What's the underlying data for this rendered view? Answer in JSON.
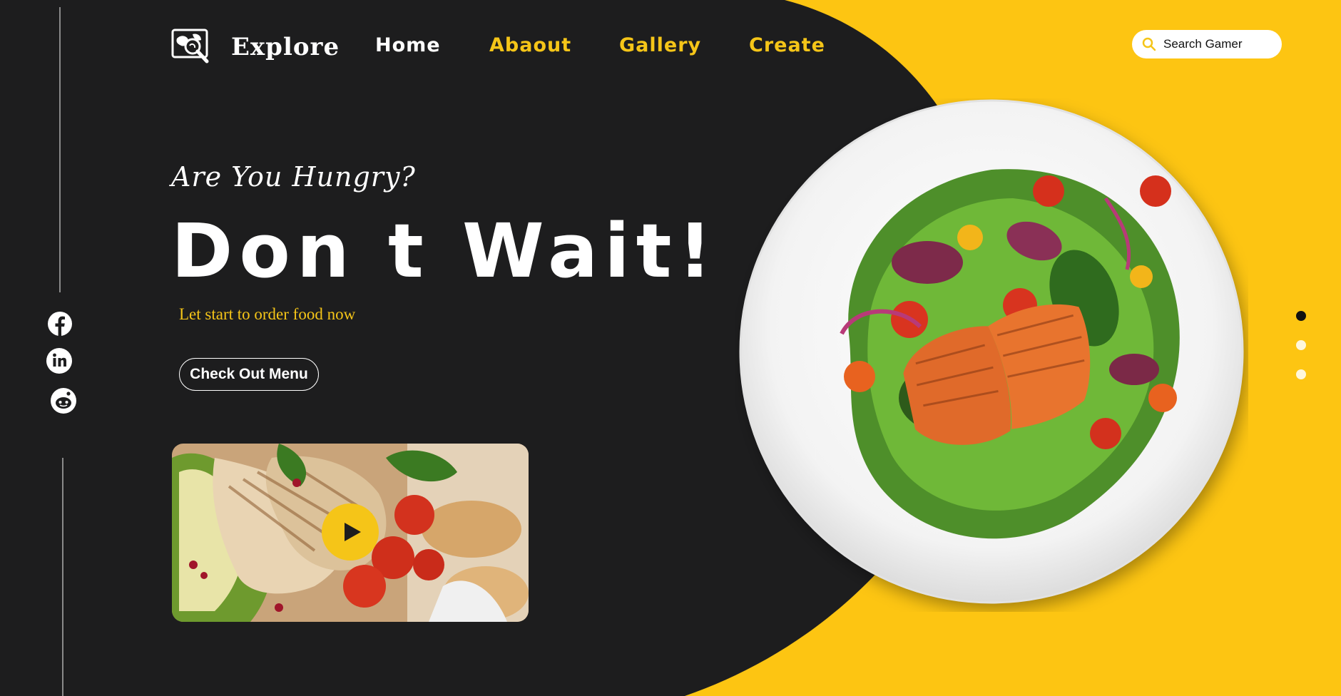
{
  "brand": {
    "name": "Explore",
    "logo_icon": "world-map-magnifier-icon"
  },
  "nav": {
    "items": [
      {
        "label": "Home",
        "color": "#ffffff"
      },
      {
        "label": "Abaout",
        "color": "#f5c518"
      },
      {
        "label": "Gallery",
        "color": "#f5c518"
      },
      {
        "label": "Create",
        "color": "#f5c518"
      }
    ]
  },
  "search": {
    "placeholder": "Search Gamer",
    "icon": "search-icon"
  },
  "hero": {
    "tagline": "Are You Hungry?",
    "headline": "Don t Wait!",
    "subtitle": "Let start to order food now",
    "cta_label": "Check Out Menu"
  },
  "social": [
    {
      "name": "facebook-icon"
    },
    {
      "name": "linkedin-icon"
    },
    {
      "name": "reddit-icon"
    }
  ],
  "video": {
    "play_icon": "play-icon"
  },
  "carousel": {
    "slides": 3,
    "active_slide": 1
  },
  "colors": {
    "background": "#1d1d1e",
    "accent": "#f5c518",
    "text": "#ffffff"
  }
}
